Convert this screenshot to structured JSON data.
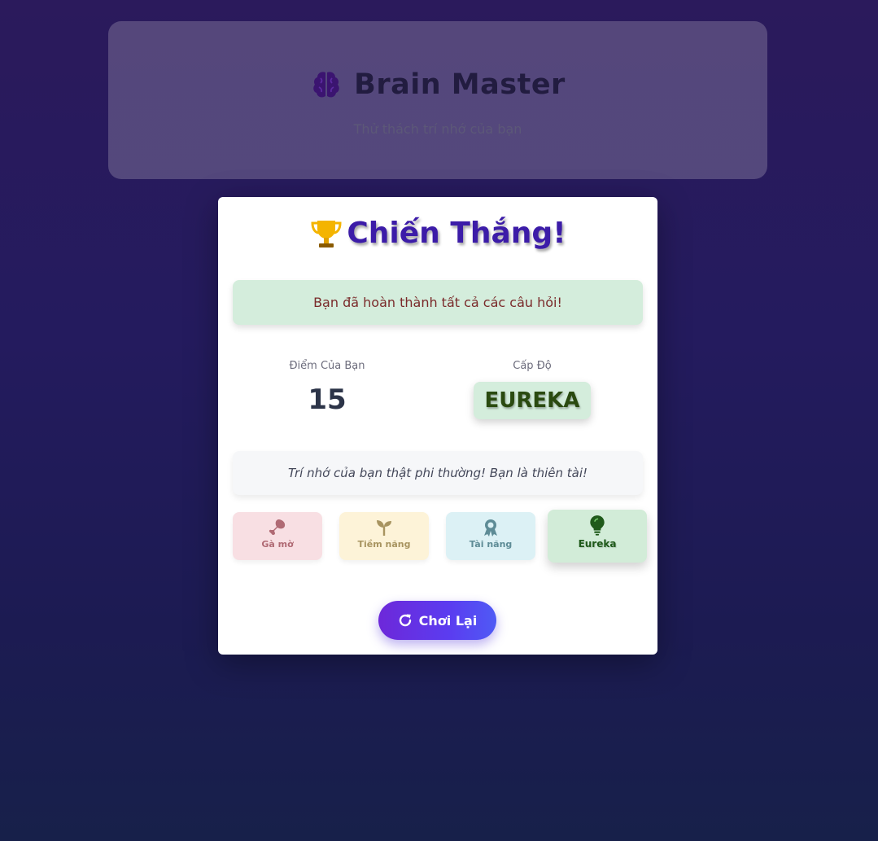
{
  "header": {
    "title": "Brain Master",
    "subtitle": "Thử thách trí nhớ của bạn",
    "icon": "brain-icon"
  },
  "result_modal": {
    "title": "Chiến Thắng!",
    "title_icon": "trophy-icon",
    "success_message": "Bạn đã hoàn thành tất cả các câu hỏi!",
    "score_label": "Điểm Của Bạn",
    "score_value": "15",
    "level_label": "Cấp Độ",
    "level_value": "EUREKA",
    "feedback": "Trí nhớ của bạn thật phi thường! Bạn là thiên tài!",
    "tiers": [
      {
        "label": "Gà mờ",
        "icon": "chicken-leg-icon",
        "active": false
      },
      {
        "label": "Tiềm năng",
        "icon": "seedling-icon",
        "active": false
      },
      {
        "label": "Tài năng",
        "icon": "award-icon",
        "active": false
      },
      {
        "label": "Eureka",
        "icon": "lightbulb-icon",
        "active": true
      }
    ],
    "play_again_label": "Chơi Lại",
    "play_again_icon": "redo-icon"
  },
  "colors": {
    "accent_purple": "#6d28d9",
    "success_bg": "#d4eddc",
    "success_text": "#7a2a2a",
    "level_text": "#2a4a10"
  }
}
